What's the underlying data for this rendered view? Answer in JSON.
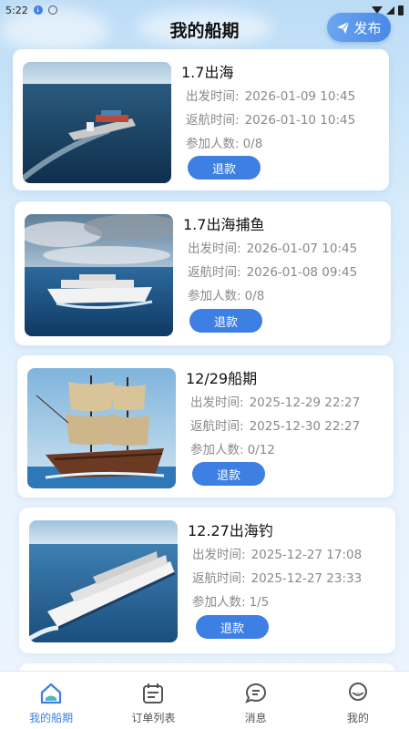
{
  "status_bar": {
    "time": "5:22"
  },
  "header": {
    "title": "我的船期",
    "publish_label": "发布"
  },
  "labels": {
    "depart": "出发时间:",
    "return": "返航时间:",
    "participants": "参加人数:"
  },
  "trips": [
    {
      "title": "1.7出海",
      "depart": "2026-01-09 10:45",
      "return": "2026-01-10 10:45",
      "participants": "0/8",
      "refund": "退款",
      "image": "cargo-ship"
    },
    {
      "title": "1.7出海捕鱼",
      "depart": "2026-01-07 10:45",
      "return": "2026-01-08 09:45",
      "participants": "0/8",
      "refund": "退款",
      "image": "cruise-ship-clouds"
    },
    {
      "title": "12/29船期",
      "depart": "2025-12-29 22:27",
      "return": "2025-12-30 22:27",
      "participants": "0/12",
      "refund": "退款",
      "image": "sailing-ship"
    },
    {
      "title": "12.27出海钓",
      "depart": "2025-12-27 17:08",
      "return": "2025-12-27 23:33",
      "participants": "1/5",
      "refund": "退款",
      "image": "cruise-ship"
    }
  ],
  "tabs": [
    {
      "label": "我的船期",
      "icon": "home-icon",
      "active": true
    },
    {
      "label": "订单列表",
      "icon": "calendar-list-icon",
      "active": false
    },
    {
      "label": "消息",
      "icon": "chat-bubble-icon",
      "active": false
    },
    {
      "label": "我的",
      "icon": "profile-icon",
      "active": false
    }
  ],
  "colors": {
    "accent": "#3d7fe3",
    "inactive_tab": "#555555",
    "muted_text": "#8a8a8a"
  }
}
